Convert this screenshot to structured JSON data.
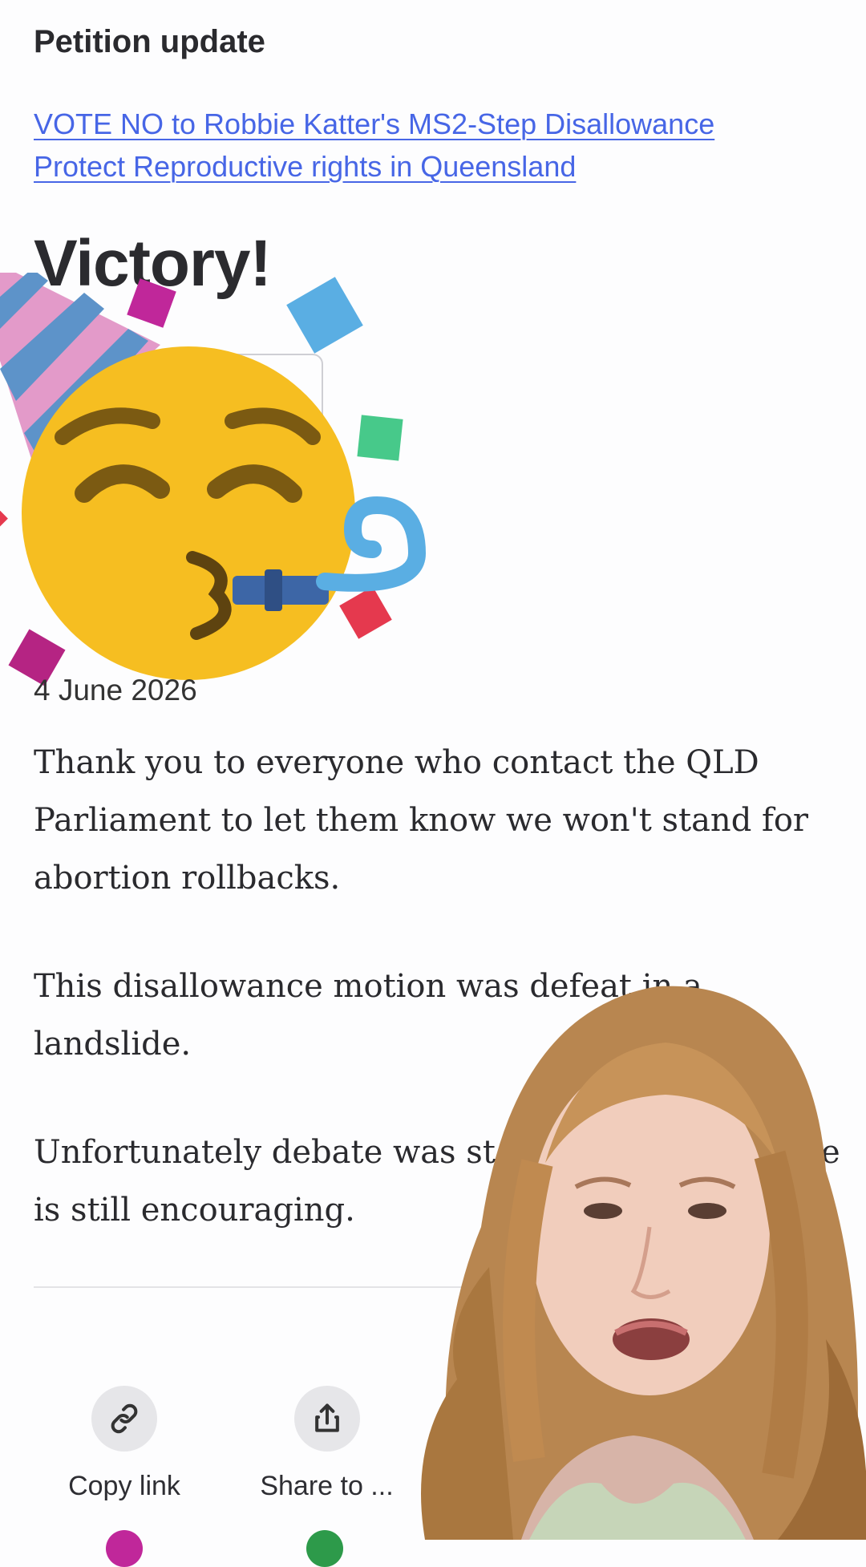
{
  "header": {
    "title": "Petition update"
  },
  "petition": {
    "link_line1": "VOTE NO to Robbie Katter's MS2-Step Disallowance",
    "link_line2": "Protect Reproductive rights in Queensland"
  },
  "update": {
    "title": "Victory!",
    "image_icon": "party-face-emoji-icon",
    "date": "4 June 2026",
    "paragraphs": [
      "Thank you to everyone who contact the QLD Parliament to let them know we won't stand for abortion rollbacks.",
      "This disallowance motion was defeat",
      "Unfortunately debate was st"
    ],
    "paragraph2_line1": "This disallowance motion was defeat",
    "paragraph2_tail": "in a",
    "paragraph2_line2": "landslide.",
    "paragraph3_line1_a": "Unfortunately debate was st",
    "paragraph3_line1_tail": "e",
    "paragraph3_line2": "is still encouraging."
  },
  "share_actions": [
    {
      "label": "Copy link",
      "icon": "link-icon"
    },
    {
      "label": "Share to ...",
      "icon": "share-icon"
    }
  ],
  "colors": {
    "link": "#4766e6",
    "emoji_face": "#f6be21",
    "accent_pink": "#c0279a",
    "accent_green": "#2d9a4a"
  }
}
